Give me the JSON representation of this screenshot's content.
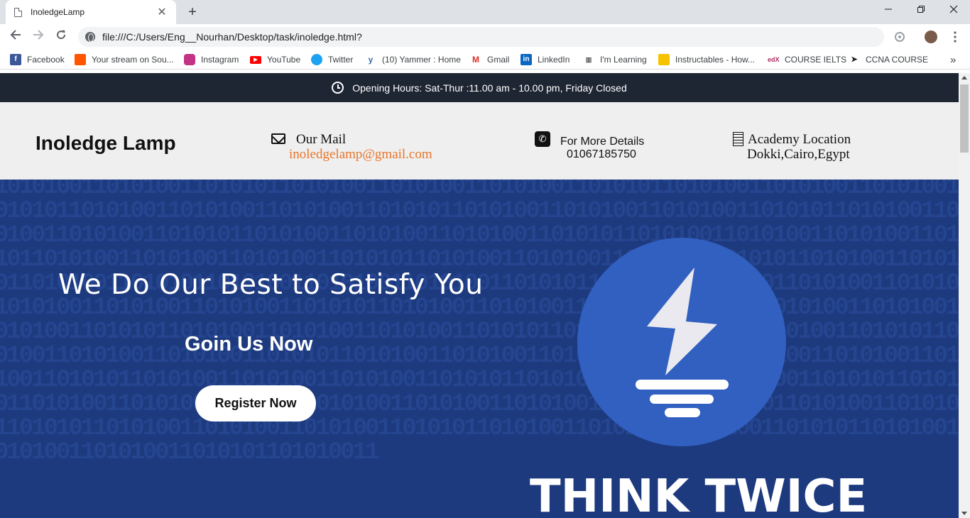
{
  "browser": {
    "tab_title": "InoledgeLamp",
    "tab_close": "✕",
    "new_tab": "+",
    "url": "file:///C:/Users/Eng__Nourhan/Desktop/task/inoledge.html?",
    "bookmarks": [
      {
        "label": "Facebook",
        "icon": "facebook-icon",
        "color": "#3b5998"
      },
      {
        "label": "Your stream on Sou...",
        "icon": "soundcloud-icon",
        "color": "#ff5500"
      },
      {
        "label": "Instagram",
        "icon": "instagram-icon",
        "color": "#c13584"
      },
      {
        "label": "YouTube",
        "icon": "youtube-icon",
        "color": "#ff0000"
      },
      {
        "label": "Twitter",
        "icon": "twitter-icon",
        "color": "#1da1f2"
      },
      {
        "label": "(10) Yammer : Home",
        "icon": "yammer-icon",
        "color": "#396aac"
      },
      {
        "label": "Gmail",
        "icon": "gmail-icon",
        "color": "#d93025"
      },
      {
        "label": "LinkedIn",
        "icon": "linkedin-icon",
        "color": "#0a66c2"
      },
      {
        "label": "I'm Learning",
        "icon": "learning-icon",
        "color": "#555555"
      },
      {
        "label": "Instructables - How...",
        "icon": "instructables-icon",
        "color": "#f7c200"
      },
      {
        "label": "COURSE IELTS",
        "icon": "edx-icon",
        "color": "#b0295f"
      },
      {
        "label": "CCNA COURSE",
        "icon": "ccna-icon",
        "color": "#222222"
      }
    ],
    "more_bookmarks": "»"
  },
  "page": {
    "opening_hours": "Opening Hours: Sat-Thur :11.00 am - 10.00 pm, Friday Closed",
    "brand": "Inoledge Lamp",
    "mail": {
      "title": "Our Mail",
      "value": "inoledgelamp@gmail.com"
    },
    "details": {
      "title": "For More Details",
      "value": "01067185750"
    },
    "location": {
      "title": "Academy Location",
      "value": "Dokki,Cairo,Egypt"
    },
    "hero": {
      "headline": "We Do Our Best to Satisfy You",
      "join": "Goin Us Now",
      "register": "Register Now",
      "logo_text": "THINK TWICE"
    }
  },
  "colors": {
    "topbar": "#1f2633",
    "infobar": "#efefef",
    "hero_bg": "#1d3a7e",
    "logo_circle": "#3160c0",
    "mail_link": "#e8762c"
  }
}
